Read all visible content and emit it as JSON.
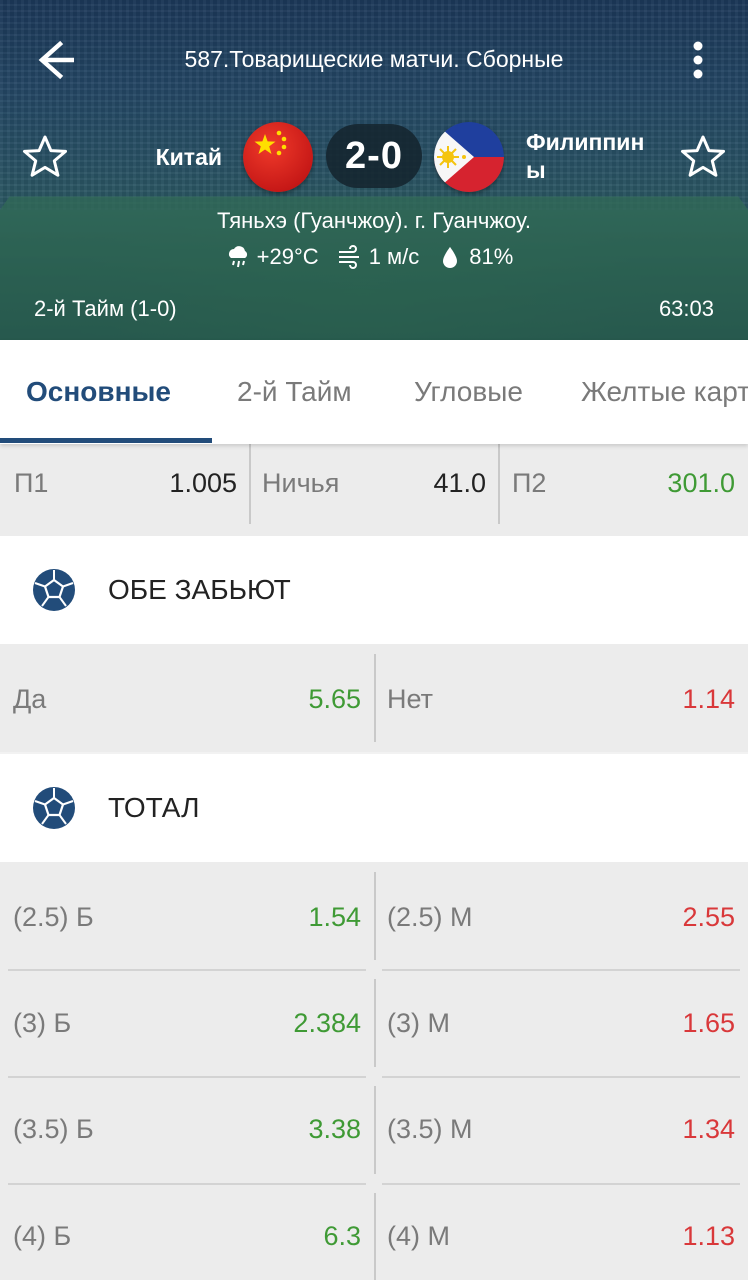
{
  "header": {
    "title": "587.Товарищеские матчи. Сборные",
    "home_team": "Китай",
    "away_team": "Филиппины",
    "score": "2-0",
    "venue": "Тяньхэ (Гуанчжоу). г. Гуанчжоу.",
    "weather": {
      "temperature": "+29°C",
      "wind": "1 м/с",
      "humidity": "81%"
    },
    "period": "2-й  Тайм (1-0)",
    "clock": "63:03"
  },
  "tabs": [
    {
      "label": "Основные",
      "active": true
    },
    {
      "label": "2-й  Тайм",
      "active": false
    },
    {
      "label": "Угловые",
      "active": false
    },
    {
      "label": "Желтые карточки",
      "active": false
    }
  ],
  "main_odds": [
    {
      "label": "П1",
      "value": "1.005"
    },
    {
      "label": "Ничья",
      "value": "41.0"
    },
    {
      "label": "П2",
      "value": "301.0"
    }
  ],
  "both_score": {
    "title": "ОБЕ ЗАБЬЮТ",
    "yes": {
      "label": "Да",
      "value": "5.65"
    },
    "no": {
      "label": "Нет",
      "value": "1.14"
    }
  },
  "total": {
    "title": "ТОТАЛ",
    "rows": [
      {
        "over_label": "(2.5) Б",
        "over_value": "1.54",
        "under_label": "(2.5) М",
        "under_value": "2.55"
      },
      {
        "over_label": "(3) Б",
        "over_value": "2.384",
        "under_label": "(3) М",
        "under_value": "1.65"
      },
      {
        "over_label": "(3.5) Б",
        "over_value": "3.38",
        "under_label": "(3.5) М",
        "under_value": "1.34"
      },
      {
        "over_label": "(4) Б",
        "over_value": "6.3",
        "under_label": "(4) М",
        "under_value": "1.13"
      }
    ]
  },
  "colors": {
    "accent": "#224c7a",
    "odds_up": "#3f9a35",
    "odds_down": "#d9383a",
    "row_bg": "#ececec"
  },
  "icons": [
    "back-arrow-icon",
    "more-vertical-icon",
    "star-outline-icon",
    "china-flag-icon",
    "philippines-flag-icon",
    "rain-cloud-icon",
    "wind-icon",
    "water-drop-icon",
    "soccer-ball-icon"
  ]
}
